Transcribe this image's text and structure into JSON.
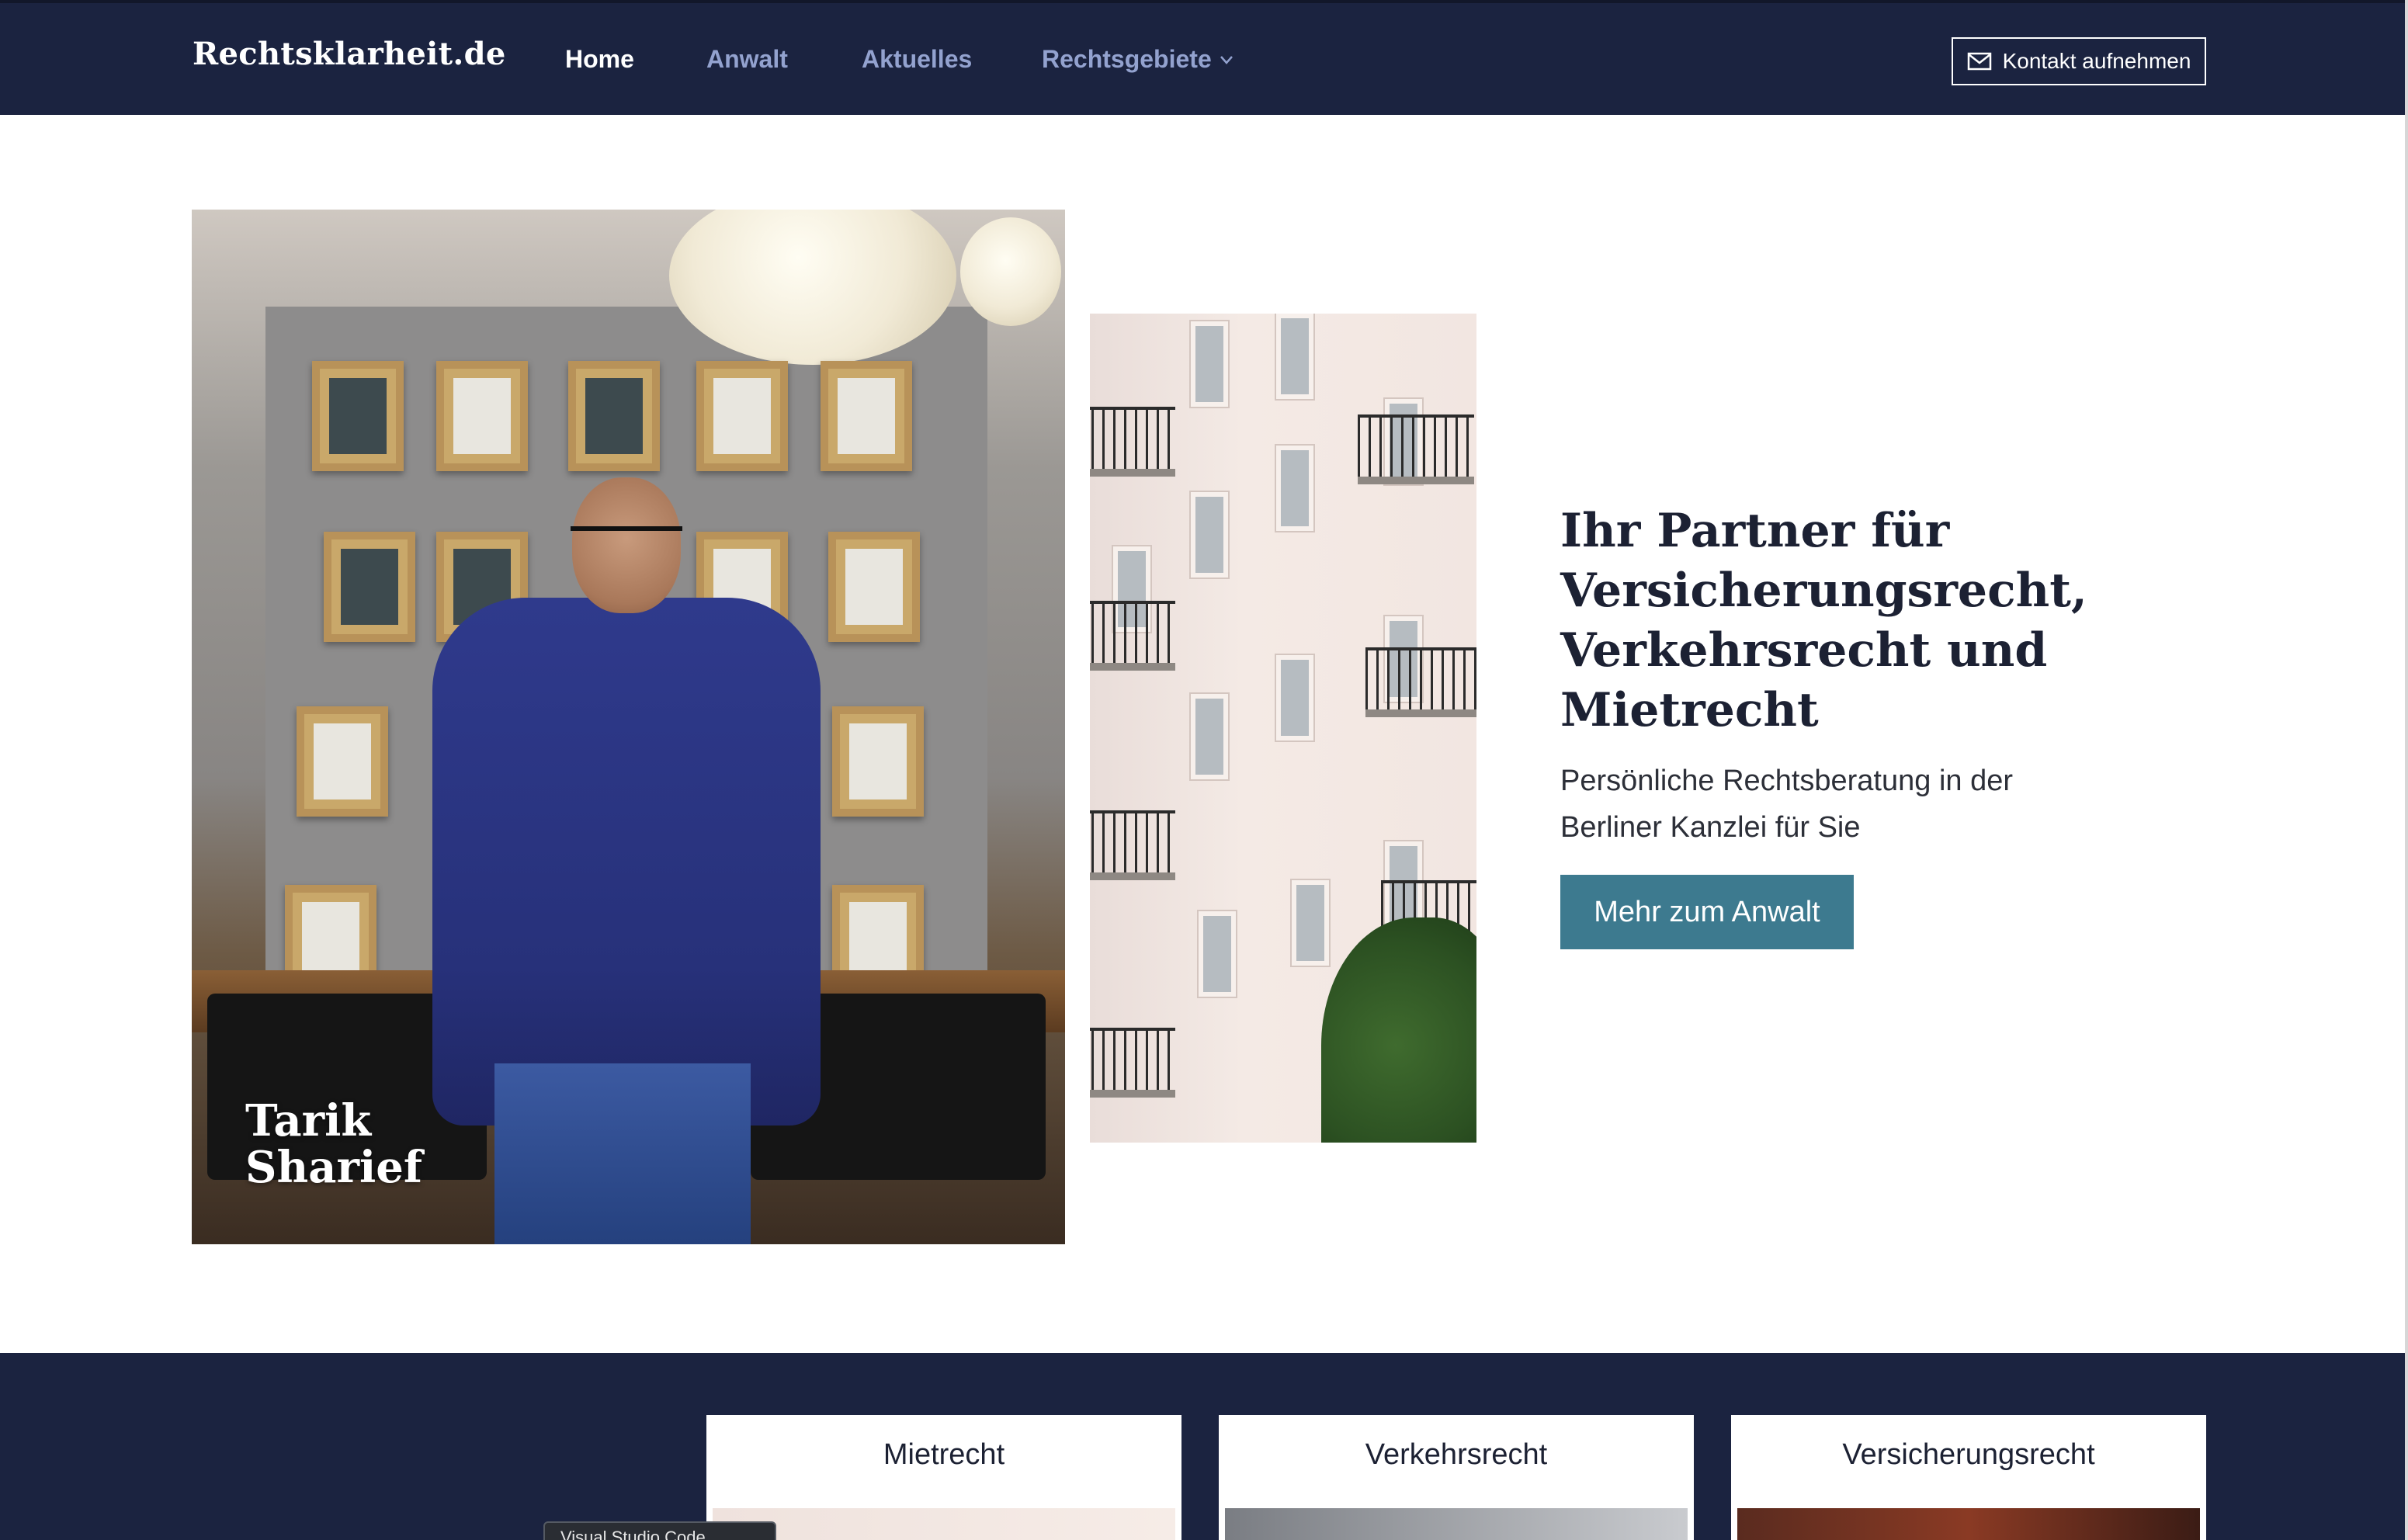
{
  "header": {
    "logo": "Rechtsklarheit.de",
    "nav": [
      {
        "label": "Home",
        "active": true
      },
      {
        "label": "Anwalt",
        "active": false
      },
      {
        "label": "Aktuelles",
        "active": false
      },
      {
        "label": "Rechtsgebiete",
        "active": false,
        "has_dropdown": true
      }
    ],
    "contact_button": "Kontakt aufnehmen",
    "contact_icon": "mail-icon",
    "dropdown_icon": "chevron-down-icon"
  },
  "hero": {
    "portrait_caption_first": "Tarik",
    "portrait_caption_last": "Sharief",
    "title": "Ihr Partner für Versicherungsrecht, Verkehrsrecht und Mietrecht",
    "subtitle": "Persönliche Rechtsberatung in der Berliner Kanzlei für Sie",
    "cta": "Mehr zum Anwalt"
  },
  "practice_areas": {
    "cards": [
      {
        "title": "Mietrecht"
      },
      {
        "title": "Verkehrsrecht"
      },
      {
        "title": "Versicherungsrecht"
      }
    ]
  },
  "overlay": {
    "tooltip": "Visual Studio Code"
  },
  "colors": {
    "navy": "#1b2340",
    "nav_inactive": "#93a2cf",
    "cta": "#3d7a8f",
    "text": "#1c2133"
  }
}
